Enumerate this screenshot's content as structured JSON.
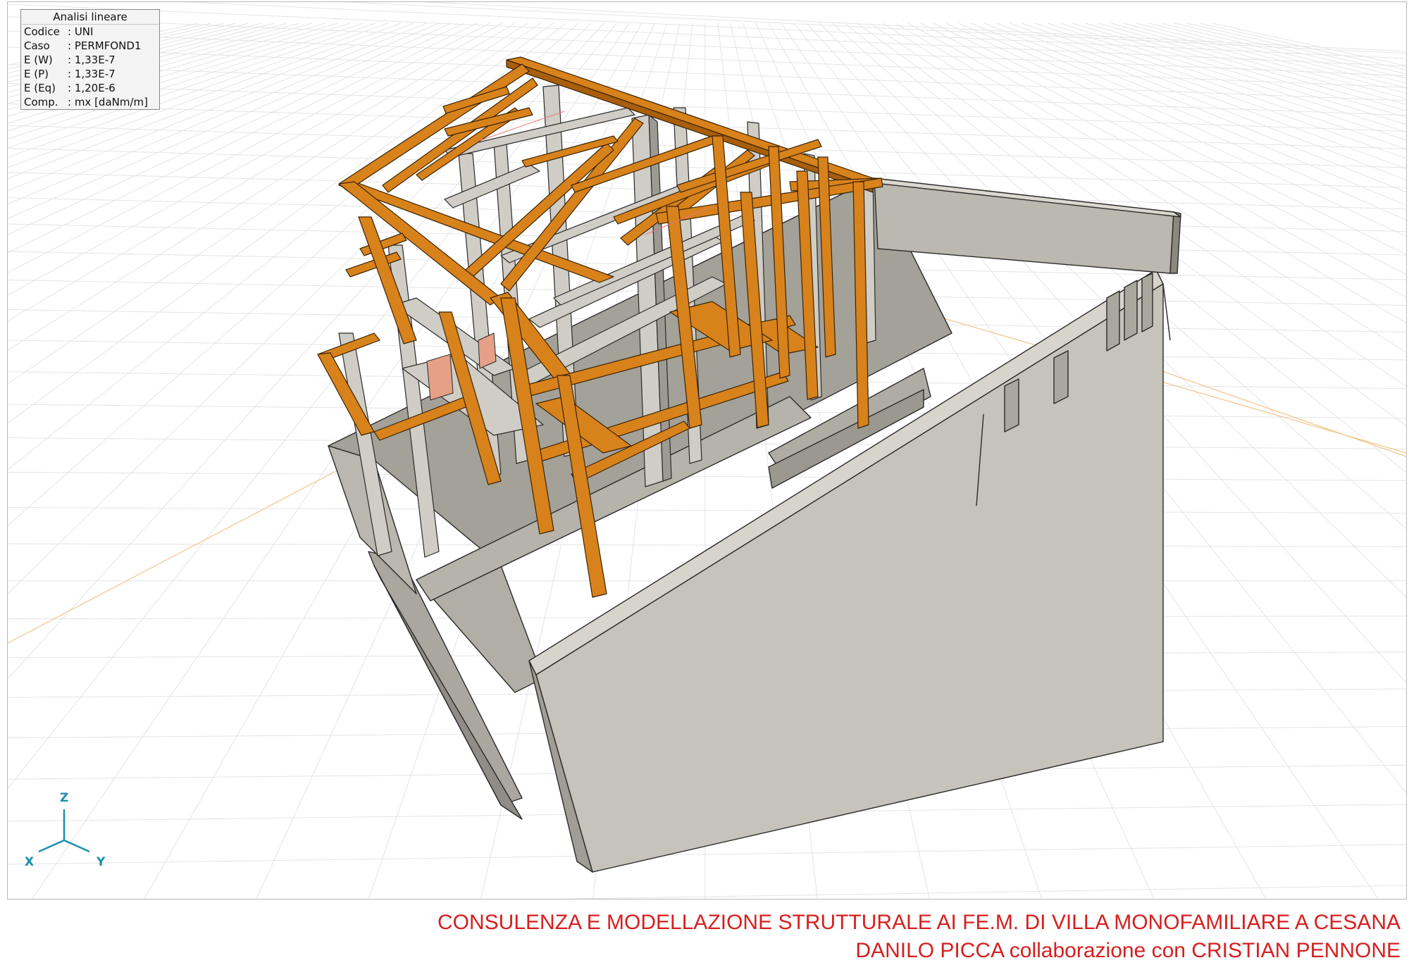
{
  "info_panel": {
    "title": "Analisi lineare",
    "rows": [
      {
        "key": "Codice",
        "value": ": UNI"
      },
      {
        "key": "Caso",
        "value": ": PERMFOND1"
      },
      {
        "key": "E (W)",
        "value": ": 1,33E-7"
      },
      {
        "key": "E (P)",
        "value": ": 1,33E-7"
      },
      {
        "key": "E (Eq)",
        "value": ": 1,20E-6"
      },
      {
        "key": "Comp.",
        "value": ": mx [daNm/m]"
      }
    ]
  },
  "axes": {
    "z": "Z",
    "x": "X",
    "y": "Y",
    "color": "#1a8fb0"
  },
  "footer": {
    "line1": "CONSULENZA E MODELLAZIONE STRUTTURALE AI FE.M. DI VILLA MONOFAMILIARE A CESANA",
    "line2": "DANILO PICCA collaborazione con CRISTIAN PENNONE"
  },
  "colors": {
    "timber": "#d8821c",
    "timber_dark": "#a85e0c",
    "concrete": "#c7c5bc",
    "concrete_dark": "#9d9b92",
    "grid": "#e3e3e3",
    "footer_text": "#d61f1f"
  }
}
